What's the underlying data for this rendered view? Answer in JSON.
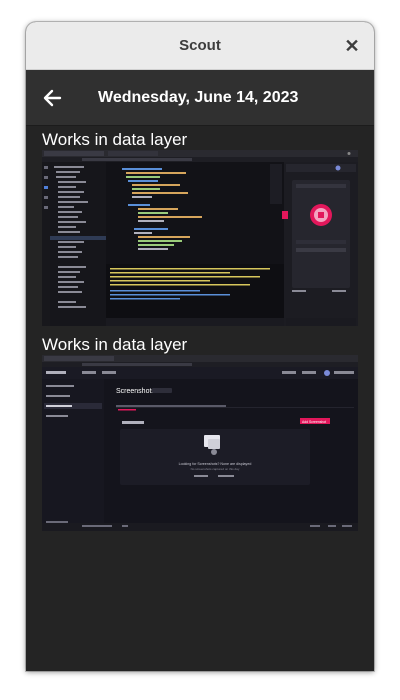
{
  "window": {
    "title": "Scout",
    "close_icon": "close-icon"
  },
  "header": {
    "back_icon": "arrow-left-icon",
    "date": "Wednesday, June 14, 2023"
  },
  "entries": [
    {
      "label": "Works in data layer"
    },
    {
      "label": "Works in data layer"
    }
  ],
  "screenshot2": {
    "page_heading": "Screenshots",
    "empty_title": "Looking for Screenshots? None are displayed",
    "empty_subtitle": "No screenshots captured on this day",
    "action_label": "Add Screenshot"
  },
  "colors": {
    "window_bg": "#242424",
    "titlebar": "#ebebeb",
    "accent": "#e2175b"
  }
}
